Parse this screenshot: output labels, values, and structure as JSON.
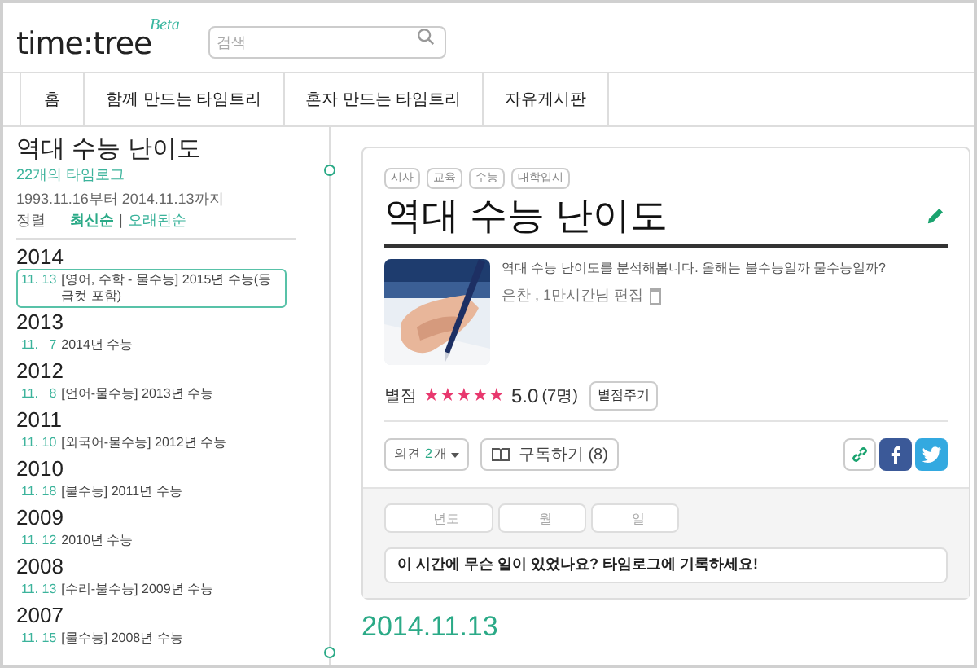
{
  "header": {
    "logo": "time:tree",
    "logo_badge": "Beta",
    "search": {
      "placeholder": "검색"
    }
  },
  "nav": [
    {
      "label": "홈"
    },
    {
      "label": "함께 만드는 타임트리"
    },
    {
      "label": "혼자 만드는 타임트리"
    },
    {
      "label": "자유게시판"
    }
  ],
  "sidebar": {
    "title": "역대 수능 난이도",
    "count": "22개의 타임로그",
    "range": "1993.11.16부터 2014.11.13까지",
    "sort_label": "정렬",
    "sort_separator": "|",
    "sort_options": [
      {
        "label": "최신순",
        "selected": true
      },
      {
        "label": "오래된순",
        "selected": false
      }
    ],
    "years": [
      {
        "year": "2014",
        "entries": [
          {
            "date": "11. 13",
            "text": "[영어, 수학 - 물수능] 2015년 수능(등급컷 포함)",
            "selected": true
          }
        ]
      },
      {
        "year": "2013",
        "entries": [
          {
            "date": "11.   7",
            "text": "2014년 수능",
            "selected": false
          }
        ]
      },
      {
        "year": "2012",
        "entries": [
          {
            "date": "11.   8",
            "text": "[언어-물수능] 2013년 수능",
            "selected": false
          }
        ]
      },
      {
        "year": "2011",
        "entries": [
          {
            "date": "11. 10",
            "text": "[외국어-물수능] 2012년 수능",
            "selected": false
          }
        ]
      },
      {
        "year": "2010",
        "entries": [
          {
            "date": "11. 18",
            "text": "[불수능] 2011년 수능",
            "selected": false
          }
        ]
      },
      {
        "year": "2009",
        "entries": [
          {
            "date": "11. 12",
            "text": "2010년 수능",
            "selected": false
          }
        ]
      },
      {
        "year": "2008",
        "entries": [
          {
            "date": "11. 13",
            "text": "[수리-불수능] 2009년 수능",
            "selected": false
          }
        ]
      },
      {
        "year": "2007",
        "entries": [
          {
            "date": "11. 15",
            "text": "[물수능] 2008년 수능",
            "selected": false
          }
        ]
      }
    ]
  },
  "card": {
    "tags": [
      "시사",
      "교육",
      "수능",
      "대학입시"
    ],
    "title": "역대 수능 난이도",
    "description": "역대 수능 난이도를 분석해봅니다. 올해는 불수능일까 물수능일까?",
    "author": "은찬 , 1만시간님 편집",
    "rating": {
      "label": "별점",
      "stars": 5,
      "score": "5.0",
      "voters": "(7명)",
      "button": "별점주기"
    },
    "opinions": {
      "label": "의견",
      "count": "2",
      "unit": "개"
    },
    "subscribe": "구독하기 (8)",
    "date_fields": [
      {
        "placeholder": "년도"
      },
      {
        "placeholder": "월"
      },
      {
        "placeholder": "일"
      }
    ],
    "prompt": "이 시간에 무슨 일이 있었나요? 타임로그에 기록하세요!"
  },
  "timeline_date": "2014.11.13"
}
